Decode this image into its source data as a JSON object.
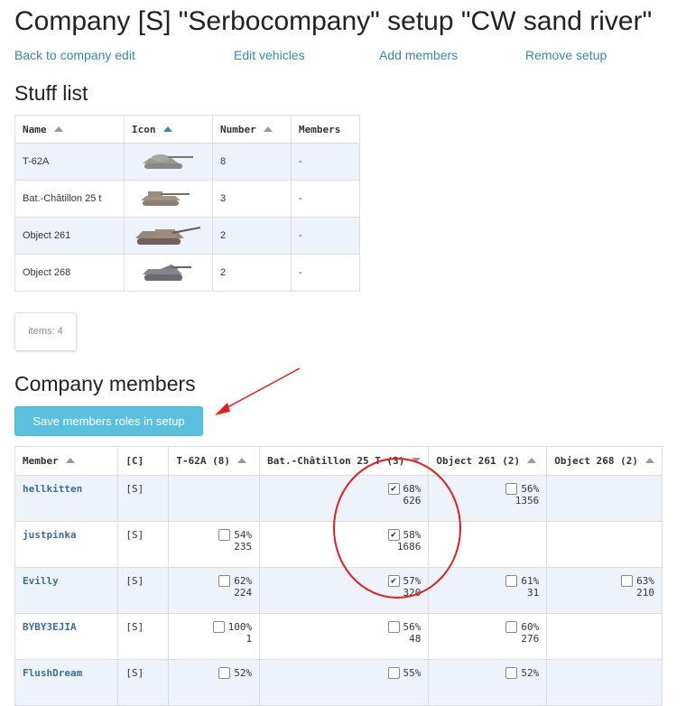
{
  "page_title": "Company [S] \"Serbocompany\" setup \"CW sand river\"",
  "links": [
    "Back to company edit",
    "Edit vehicles",
    "Add members",
    "Remove setup"
  ],
  "stuff": {
    "heading": "Stuff list",
    "columns": [
      "Name",
      "Icon",
      "Number",
      "Members"
    ],
    "rows": [
      {
        "name": "T-62A",
        "icon": "tank-t62a-icon",
        "number": "8",
        "members": "-"
      },
      {
        "name": "Bat.-Châtillon 25 t",
        "icon": "tank-batchat-icon",
        "number": "3",
        "members": "-"
      },
      {
        "name": "Object 261",
        "icon": "tank-object261-icon",
        "number": "2",
        "members": "-"
      },
      {
        "name": "Object 268",
        "icon": "tank-object268-icon",
        "number": "2",
        "members": "-"
      }
    ],
    "items_label": "items: 4"
  },
  "members": {
    "heading": "Company members",
    "save_label": "Save members roles in setup",
    "columns": [
      "Member",
      "[C]",
      "T-62A (8)",
      "Bat.-Châtillon 25 T (3)",
      "Object 261 (2)",
      "Object 268 (2)"
    ],
    "rows": [
      {
        "name": "hellkitten",
        "role": "[S]",
        "cells": [
          null,
          {
            "checked": true,
            "pct": "68%",
            "battles": "626"
          },
          {
            "checked": false,
            "pct": "56%",
            "battles": "1356"
          },
          null
        ]
      },
      {
        "name": "justpinka",
        "role": "[S]",
        "cells": [
          {
            "checked": false,
            "pct": "54%",
            "battles": "235"
          },
          {
            "checked": true,
            "pct": "58%",
            "battles": "1686"
          },
          null,
          null
        ]
      },
      {
        "name": "Evilly",
        "role": "[S]",
        "cells": [
          {
            "checked": false,
            "pct": "62%",
            "battles": "224"
          },
          {
            "checked": true,
            "pct": "57%",
            "battles": "320"
          },
          {
            "checked": false,
            "pct": "61%",
            "battles": "31"
          },
          {
            "checked": false,
            "pct": "63%",
            "battles": "210"
          }
        ]
      },
      {
        "name": "BYBY3EJIA",
        "role": "[S]",
        "cells": [
          {
            "checked": false,
            "pct": "100%",
            "battles": "1"
          },
          {
            "checked": false,
            "pct": "56%",
            "battles": "48"
          },
          {
            "checked": false,
            "pct": "60%",
            "battles": "276"
          },
          null
        ]
      },
      {
        "name": "FlushDream",
        "role": "[S]",
        "cells": [
          {
            "checked": false,
            "pct": "52%",
            "battles": ""
          },
          {
            "checked": false,
            "pct": "55%",
            "battles": ""
          },
          {
            "checked": false,
            "pct": "52%",
            "battles": ""
          },
          null
        ]
      }
    ]
  },
  "colors": {
    "link": "#3a87ad",
    "button": "#5bc0de",
    "annotation": "#e02020",
    "row_stripe": "#eef3fb"
  }
}
